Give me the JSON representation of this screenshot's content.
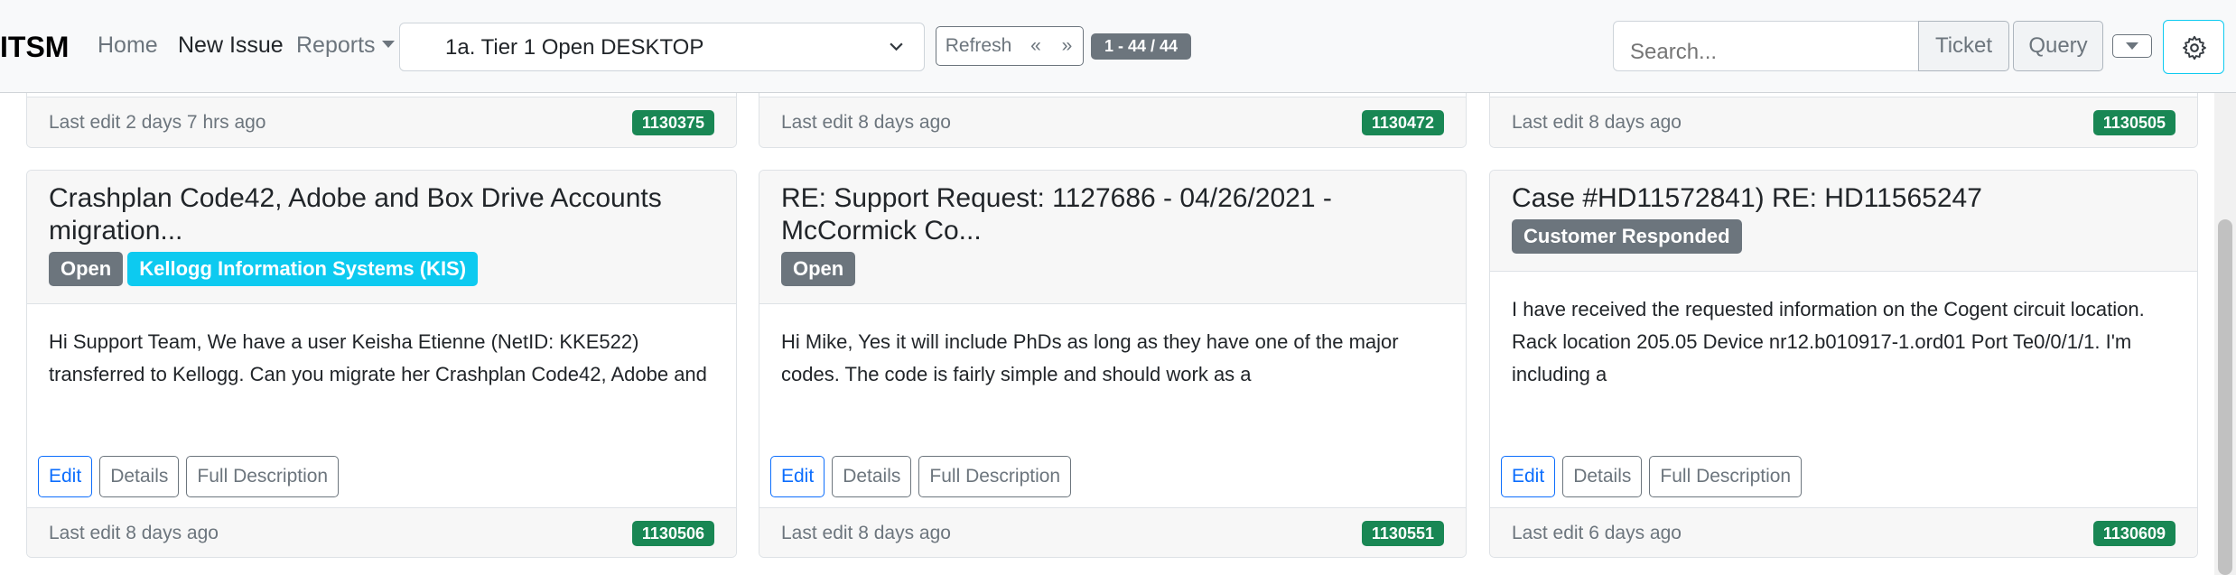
{
  "nav": {
    "brand": "ITSM",
    "home": "Home",
    "new_issue": "New Issue",
    "reports": "Reports",
    "queue_select": "1a. Tier 1 Open DESKTOP",
    "refresh": "Refresh",
    "prev": "«",
    "next": "»",
    "count": "1 - 44 / 44",
    "search_placeholder": "Search...",
    "ticket": "Ticket",
    "query": "Query"
  },
  "colors": {
    "badge_open": "#6c757d",
    "badge_kis": "#0dcaf0",
    "badge_id": "#198754",
    "primary": "#0d6efd"
  },
  "top_cards": [
    {
      "last_edit": "Last edit 2 days 7 hrs ago",
      "id": "1130375"
    },
    {
      "last_edit": "Last edit 8 days ago",
      "id": "1130472"
    },
    {
      "last_edit": "Last edit 8 days ago",
      "id": "1130505"
    }
  ],
  "cards": [
    {
      "title": "Crashplan Code42, Adobe and Box Drive Accounts migration...",
      "badges": [
        "Open",
        "Kellogg Information Systems (KIS)"
      ],
      "body": "Hi Support Team, We have a user Keisha Etienne (NetID: KKE522) transferred to Kellogg. Can you migrate her Crashplan Code42, Adobe and",
      "edit": "Edit",
      "details": "Details",
      "full": "Full Description",
      "last_edit": "Last edit 8 days ago",
      "id": "1130506"
    },
    {
      "title": "RE: Support Request: 1127686 - 04/26/2021 - McCormick Co...",
      "badges": [
        "Open"
      ],
      "body": "Hi Mike, Yes it will include PhDs as long as they have one of the major codes. The code is fairly simple and should work as a",
      "edit": "Edit",
      "details": "Details",
      "full": "Full Description",
      "last_edit": "Last edit 8 days ago",
      "id": "1130551"
    },
    {
      "title": "Case #HD11572841) RE: HD11565247",
      "badges": [
        "Customer Responded"
      ],
      "body": "I have received the requested information on the Cogent circuit location. Rack location 205.05 Device nr12.b010917-1.ord01 Port Te0/0/1/1. I'm including a",
      "edit": "Edit",
      "details": "Details",
      "full": "Full Description",
      "last_edit": "Last edit 6 days ago",
      "id": "1130609"
    }
  ]
}
